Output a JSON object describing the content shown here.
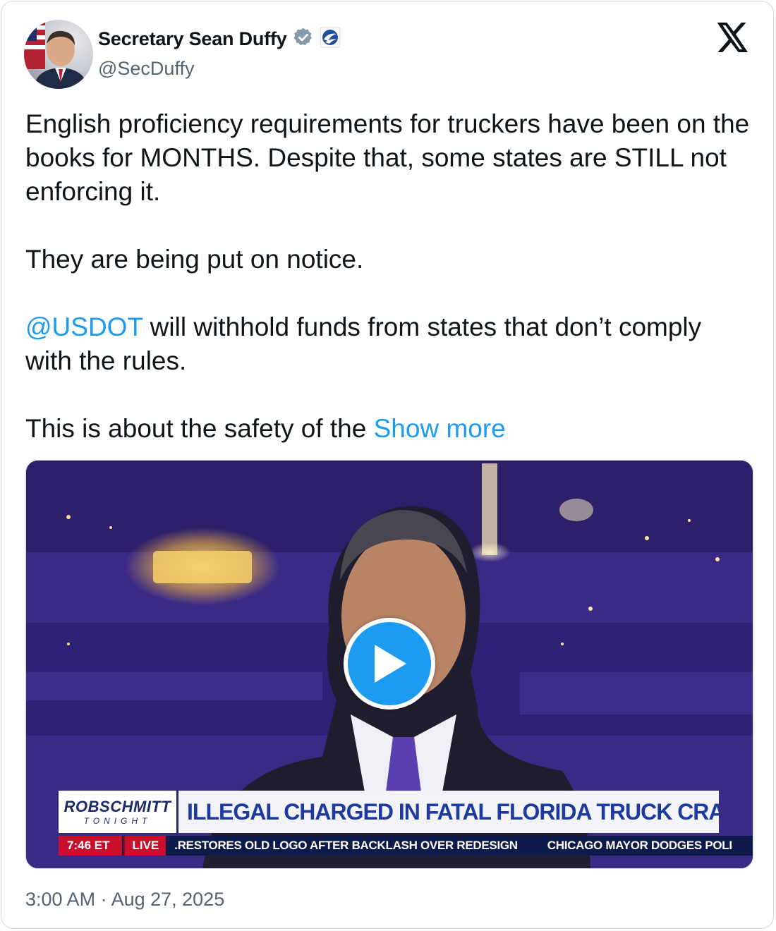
{
  "author": {
    "display_name": "Secretary Sean Duffy",
    "handle": "@SecDuffy",
    "verified_badge": "gray-checkmark-badge",
    "affiliate_badge": "usdot-logo-badge"
  },
  "tweet": {
    "line_1": "English proficiency requirements for truckers have been on the books for MONTHS. Despite that, some states are STILL not enforcing it.",
    "line_2": "They are being put on notice.",
    "mention": "@USDOT",
    "line_3_rest": " will withhold funds from states that don’t comply with the rules.",
    "line_4": "This is about the safety of the ",
    "show_more": "Show more"
  },
  "video": {
    "show_logo_top": "ROBSCHMITT",
    "show_logo_bottom": "TONIGHT",
    "headline": "ILLEGAL CHARGED IN FATAL FLORIDA TRUCK CRASH",
    "time": "7:46 ET",
    "live": "LIVE",
    "ticker_1": ".RESTORES OLD LOGO AFTER BACKLASH OVER REDESIGN",
    "ticker_2": "CHICAGO MAYOR DODGES POLI"
  },
  "timestamp": "3:00 AM · Aug 27, 2025",
  "colors": {
    "link": "#1d9bf0",
    "secondary_text": "#536471",
    "primary_text": "#0f1419",
    "border": "#cfd9de"
  }
}
